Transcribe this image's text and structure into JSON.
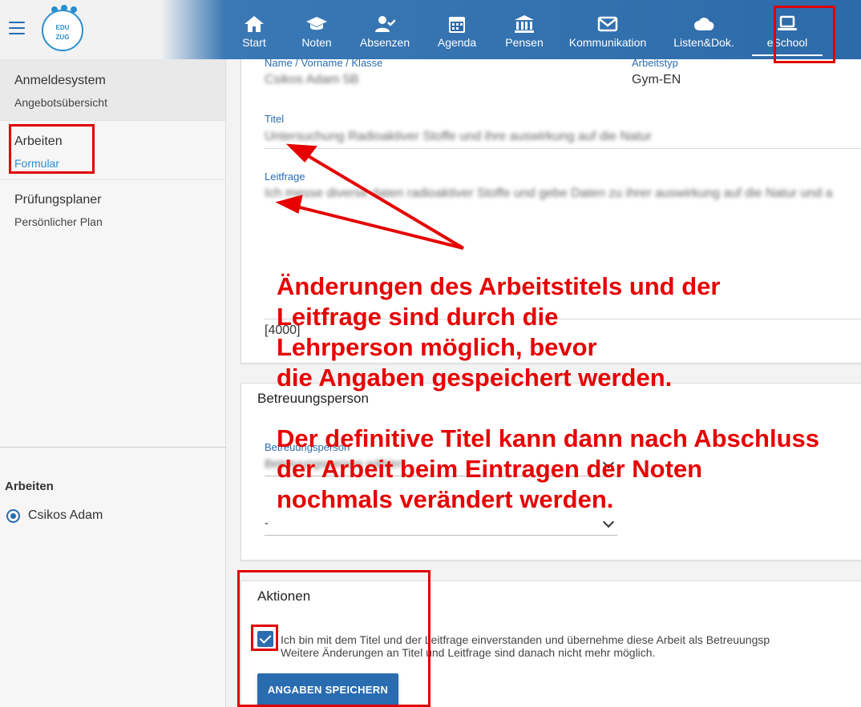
{
  "header": {
    "logo": {
      "line1": "EDU",
      "line2": "ZUG"
    },
    "nav": [
      {
        "label": "Start",
        "icon": "home-icon"
      },
      {
        "label": "Noten",
        "icon": "graduation-cap-icon"
      },
      {
        "label": "Absenzen",
        "icon": "user-check-icon"
      },
      {
        "label": "Agenda",
        "icon": "calendar-icon"
      },
      {
        "label": "Pensen",
        "icon": "bank-icon"
      },
      {
        "label": "Kommunikation",
        "icon": "envelope-icon"
      },
      {
        "label": "Listen&Dok.",
        "icon": "cloud-icon"
      },
      {
        "label": "eSchool",
        "icon": "laptop-icon",
        "active": true
      }
    ]
  },
  "sidebar": {
    "groups": [
      {
        "title": "Anmeldesystem",
        "item": "Angebotsübersicht"
      },
      {
        "title": "Arbeiten",
        "item": "Formular"
      },
      {
        "title": "Prüfungsplaner",
        "item": "Persönlicher Plan"
      }
    ],
    "lower_title": "Arbeiten",
    "person": "Csikos Adam"
  },
  "form": {
    "name_label": "Name / Vorname / Klasse",
    "name_value": "Csikos Adam 5B",
    "type_label": "Arbeitstyp",
    "type_value": "Gym-EN",
    "title_label": "Titel",
    "title_value": "Untersuchung Radioaktiver Stoffe und ihre auswirkung auf die Natur",
    "question_label": "Leitfrage",
    "question_value": "Ich messe diverse daten radioaktiver Stoffe und gebe Daten zu ihrer auswirkung auf die Natur und a",
    "char_count": "[4000]"
  },
  "betreuung": {
    "heading": "Betreuungsperson",
    "field_label": "Betreuungsperson",
    "field_value": "Betreuungsperson wählen",
    "second_value": "-"
  },
  "aktionen": {
    "heading": "Aktionen",
    "consent_line1": "Ich bin mit dem Titel und der Leitfrage einverstanden und übernehme diese Arbeit als Betreuungsp",
    "consent_line2": "Weitere Änderungen an Titel und Leitfrage sind danach nicht mehr möglich.",
    "checkbox_checked": true,
    "save_label": "ANGABEN SPEICHERN"
  },
  "annotations": {
    "lines_a": [
      "Änderungen des Arbeitstitels und der",
      "Leitfrage sind durch die",
      "Lehrperson möglich, bevor",
      "die Angaben gespeichert werden."
    ],
    "lines_b": [
      "Der definitive Titel kann dann nach Abschluss",
      "der Arbeit beim Eintragen der Noten",
      "nochmals verändert werden."
    ],
    "color": "#e60000"
  },
  "colors": {
    "brand": "#2a6cb0",
    "header": "#2d6aa9",
    "accent": "#2a8fcf"
  }
}
